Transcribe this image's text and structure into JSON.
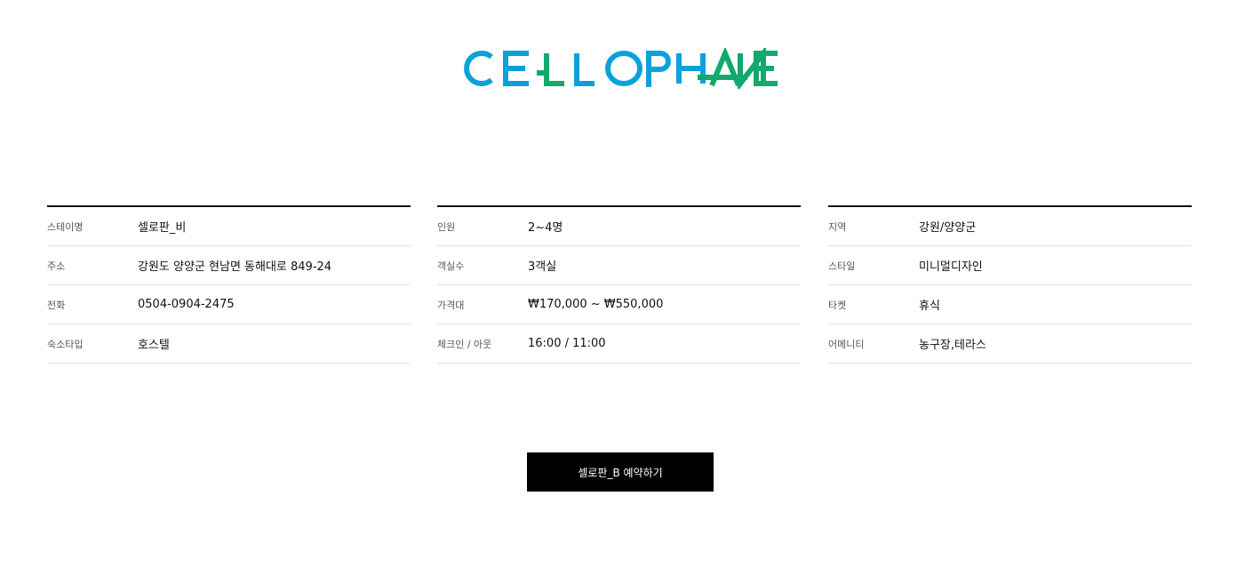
{
  "brand": {
    "logo_text": "CELLOPHANE",
    "colors": {
      "blue": "#0aa2d8",
      "green": "#11a96c"
    }
  },
  "details": {
    "columns": [
      {
        "rows": [
          {
            "label": "스테이명",
            "value": "셀로판_비"
          },
          {
            "label": "주소",
            "value": "강원도 양양군 현남면 동해대로 849-24"
          },
          {
            "label": "전화",
            "value": "0504-0904-2475"
          },
          {
            "label": "숙소타입",
            "value": "호스텔"
          }
        ]
      },
      {
        "rows": [
          {
            "label": "인원",
            "value": "2~4명"
          },
          {
            "label": "객실수",
            "value": "3객실"
          },
          {
            "label": "가격대",
            "value": "₩170,000 ~ ₩550,000"
          },
          {
            "label": "체크인 / 아웃",
            "value": "16:00 / 11:00"
          }
        ]
      },
      {
        "rows": [
          {
            "label": "지역",
            "value": "강원/양양군"
          },
          {
            "label": "스타일",
            "value": "미니멀디자인"
          },
          {
            "label": "타켓",
            "value": "휴식"
          },
          {
            "label": "어메니티",
            "value": "농구장,테라스"
          }
        ]
      }
    ]
  },
  "reserve_button": {
    "label": "셀로판_B 예약하기"
  }
}
